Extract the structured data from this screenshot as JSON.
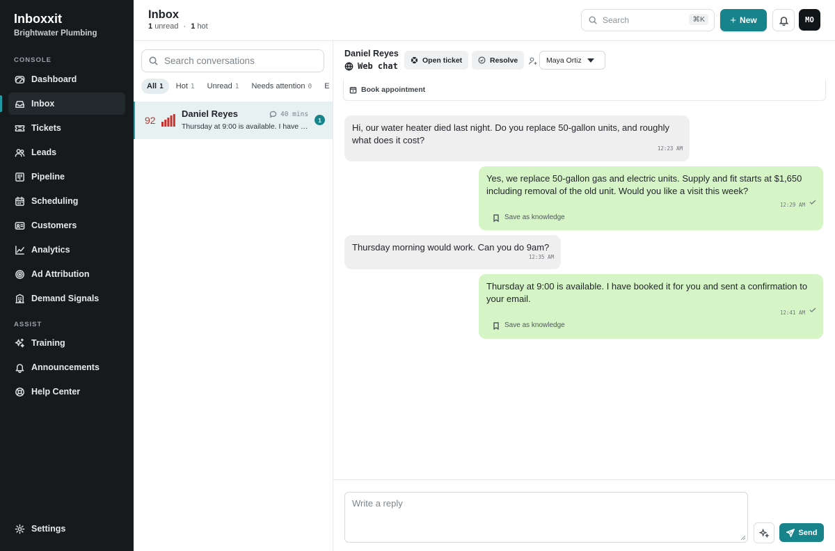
{
  "sidebar": {
    "brand": "Inboxxit",
    "org": "Brightwater Plumbing",
    "console_label": "CONSOLE",
    "assist_label": "ASSIST",
    "items": [
      {
        "label": "Dashboard",
        "icon": "gauge-icon"
      },
      {
        "label": "Inbox",
        "icon": "inbox-icon",
        "active": true
      },
      {
        "label": "Tickets",
        "icon": "ticket-icon"
      },
      {
        "label": "Leads",
        "icon": "users-icon"
      },
      {
        "label": "Pipeline",
        "icon": "kanban-icon"
      },
      {
        "label": "Scheduling",
        "icon": "calendar-icon"
      },
      {
        "label": "Customers",
        "icon": "id-card-icon"
      },
      {
        "label": "Analytics",
        "icon": "line-chart-icon"
      },
      {
        "label": "Ad Attribution",
        "icon": "target-icon"
      },
      {
        "label": "Demand Signals",
        "icon": "building-icon"
      }
    ],
    "assist_items": [
      {
        "label": "Training",
        "icon": "sparkles-icon"
      },
      {
        "label": "Announcements",
        "icon": "bell-icon"
      },
      {
        "label": "Help Center",
        "icon": "life-buoy-icon"
      }
    ],
    "settings": "Settings"
  },
  "header": {
    "title": "Inbox",
    "unread_count": "1",
    "unread_label": "unread",
    "separator": "·",
    "hot_count": "1",
    "hot_label": "hot",
    "search_placeholder": "Search",
    "search_shortcut": "⌘K",
    "new_button": "New",
    "avatar_initials": "MO"
  },
  "conversation_list": {
    "search_placeholder": "Search conversations",
    "filters": [
      {
        "label": "All",
        "count": "1",
        "active": true
      },
      {
        "label": "Hot",
        "count": "1"
      },
      {
        "label": "Unread",
        "count": "1"
      },
      {
        "label": "Needs attention",
        "count": "0"
      },
      {
        "label": "E",
        "count": ""
      }
    ],
    "conversations": [
      {
        "score": "92",
        "name": "Daniel Reyes",
        "time": "40 mins",
        "preview": "Thursday at 9:00 is available. I have booked it for you and sent a confirmation to your email.",
        "unread": "1"
      }
    ]
  },
  "chat": {
    "contact_name": "Daniel Reyes",
    "channel": "Web chat",
    "open_ticket": "Open ticket",
    "resolve": "Resolve",
    "assignee": "Maya Ortiz",
    "book_appointment": "Book appointment",
    "save_knowledge_label": "Save as knowledge",
    "messages": [
      {
        "direction": "in",
        "text": "Hi, our water heater died last night. Do you replace 50-gallon units, and roughly what does it cost?",
        "time": "12:23 AM"
      },
      {
        "direction": "out",
        "text": "Yes, we replace 50-gallon gas and electric units. Supply and fit starts at $1,650 including removal of the old unit. Would you like a visit this week?",
        "time": "12:29 AM"
      },
      {
        "direction": "in",
        "text": "Thursday morning would work. Can you do 9am?",
        "time": "12:35 AM"
      },
      {
        "direction": "out",
        "text": "Thursday at 9:00 is available. I have booked it for you and sent a confirmation to your email.",
        "time": "12:41 AM"
      }
    ],
    "reply_placeholder": "Write a reply",
    "send": "Send"
  },
  "colors": {
    "accent": "#17838b",
    "sidebar_bg": "#161a1d",
    "incoming_bubble": "#efefef",
    "outgoing_bubble": "#d6f5c6",
    "hot_score": "#c9312c"
  }
}
